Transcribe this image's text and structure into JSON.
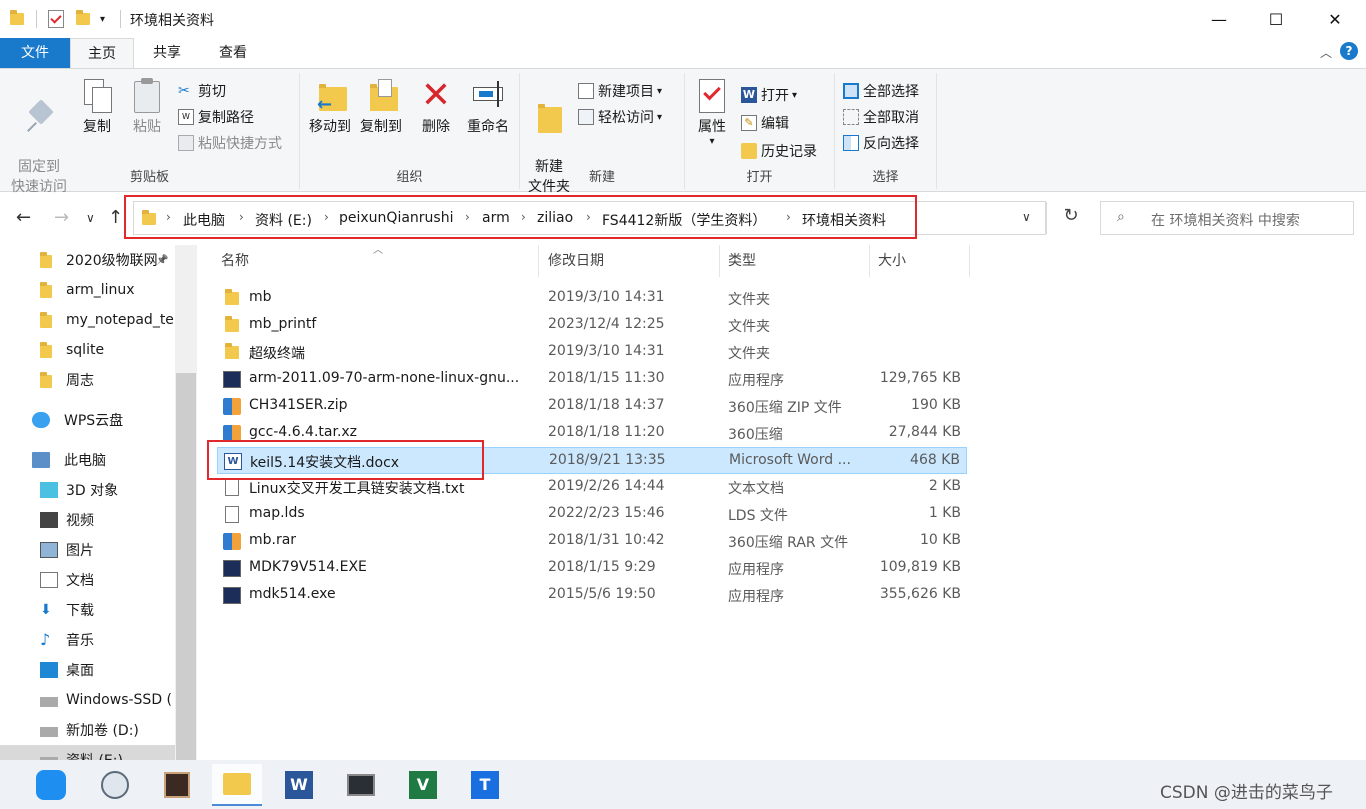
{
  "window": {
    "title": "环境相关资料",
    "minimize_glyph": "—",
    "maximize_glyph": "☐",
    "close_glyph": "✕"
  },
  "ribbon_tabs": [
    "文件",
    "主页",
    "共享",
    "查看"
  ],
  "ribbon": {
    "clipboard": {
      "pin": "固定到\n快速访问",
      "copy": "复制",
      "paste": "粘贴",
      "cut": "剪切",
      "copy_path": "复制路径",
      "paste_shortcut": "粘贴快捷方式",
      "label": "剪贴板"
    },
    "organize": {
      "move_to": "移动到",
      "copy_to": "复制到",
      "delete": "删除",
      "rename": "重命名",
      "label": "组织"
    },
    "new": {
      "new_folder": "新建\n文件夹",
      "new_item": "新建项目",
      "easy_access": "轻松访问",
      "label": "新建"
    },
    "open": {
      "properties": "属性",
      "open": "打开",
      "edit": "编辑",
      "history": "历史记录",
      "label": "打开"
    },
    "select": {
      "select_all": "全部选择",
      "select_none": "全部取消",
      "invert": "反向选择",
      "label": "选择"
    }
  },
  "address": {
    "crumbs": [
      "此电脑",
      "资料 (E:)",
      "peixunQianrushi",
      "arm",
      "ziliao",
      "FS4412新版（学生资料）",
      "环境相关资料"
    ],
    "search_placeholder": "在 环境相关资料 中搜索"
  },
  "sidebar": [
    {
      "label": "2020级物联网",
      "icon": "folder-icon",
      "pinned": true
    },
    {
      "label": "arm_linux",
      "icon": "folder-icon"
    },
    {
      "label": "my_notepad_te",
      "icon": "folder-icon"
    },
    {
      "label": "sqlite",
      "icon": "folder-icon"
    },
    {
      "label": "周志",
      "icon": "folder-icon"
    },
    {
      "label": "WPS云盘",
      "icon": "cloud-icon"
    },
    {
      "label": "此电脑",
      "icon": "computer-icon"
    },
    {
      "label": "3D 对象",
      "icon": "cube-icon"
    },
    {
      "label": "视频",
      "icon": "video-icon"
    },
    {
      "label": "图片",
      "icon": "picture-icon"
    },
    {
      "label": "文档",
      "icon": "document-icon"
    },
    {
      "label": "下载",
      "icon": "download-icon"
    },
    {
      "label": "音乐",
      "icon": "music-icon"
    },
    {
      "label": "桌面",
      "icon": "desktop-icon"
    },
    {
      "label": "Windows-SSD (",
      "icon": "drive-icon"
    },
    {
      "label": "新加卷 (D:)",
      "icon": "drive-icon"
    },
    {
      "label": "资料 (E:)",
      "icon": "drive-icon"
    }
  ],
  "columns": [
    "名称",
    "修改日期",
    "类型",
    "大小"
  ],
  "files": [
    {
      "name": "mb",
      "date": "2019/3/10 14:31",
      "type": "文件夹",
      "size": "",
      "icon": "folder-icon"
    },
    {
      "name": "mb_printf",
      "date": "2023/12/4 12:25",
      "type": "文件夹",
      "size": "",
      "icon": "folder-icon"
    },
    {
      "name": "超级终端",
      "date": "2019/3/10 14:31",
      "type": "文件夹",
      "size": "",
      "icon": "folder-icon"
    },
    {
      "name": "arm-2011.09-70-arm-none-linux-gnu...",
      "date": "2018/1/15 11:30",
      "type": "应用程序",
      "size": "129,765 KB",
      "icon": "installer-icon"
    },
    {
      "name": "CH341SER.zip",
      "date": "2018/1/18 14:37",
      "type": "360压缩 ZIP 文件",
      "size": "190 KB",
      "icon": "archive-icon"
    },
    {
      "name": "gcc-4.6.4.tar.xz",
      "date": "2018/1/18 11:20",
      "type": "360压缩",
      "size": "27,844 KB",
      "icon": "archive-icon"
    },
    {
      "name": "keil5.14安装文档.docx",
      "date": "2018/9/21 13:35",
      "type": "Microsoft Word ...",
      "size": "468 KB",
      "icon": "word-doc-icon",
      "selected": true
    },
    {
      "name": "Linux交叉开发工具链安装文档.txt",
      "date": "2019/2/26 14:44",
      "type": "文本文档",
      "size": "2 KB",
      "icon": "text-file-icon"
    },
    {
      "name": "map.lds",
      "date": "2022/2/23 15:46",
      "type": "LDS 文件",
      "size": "1 KB",
      "icon": "blank-file-icon"
    },
    {
      "name": "mb.rar",
      "date": "2018/1/31 10:42",
      "type": "360压缩 RAR 文件",
      "size": "10 KB",
      "icon": "archive-icon"
    },
    {
      "name": "MDK79V514.EXE",
      "date": "2018/1/15 9:29",
      "type": "应用程序",
      "size": "109,819 KB",
      "icon": "installer-icon"
    },
    {
      "name": "mdk514.exe",
      "date": "2015/5/6 19:50",
      "type": "应用程序",
      "size": "355,626 KB",
      "icon": "installer-icon"
    }
  ],
  "taskbar": [
    "chat-app-icon",
    "avatar-app-icon",
    "lesson-app-icon",
    "file-explorer-icon",
    "word-icon",
    "remote-desktop-icon",
    "wps-sheet-icon",
    "tencent-docs-icon"
  ],
  "watermark": "CSDN @进击的菜鸟子",
  "colors": {
    "accent": "#1979ca",
    "selection": "#cce8ff",
    "highlight_box": "#e0282d"
  }
}
